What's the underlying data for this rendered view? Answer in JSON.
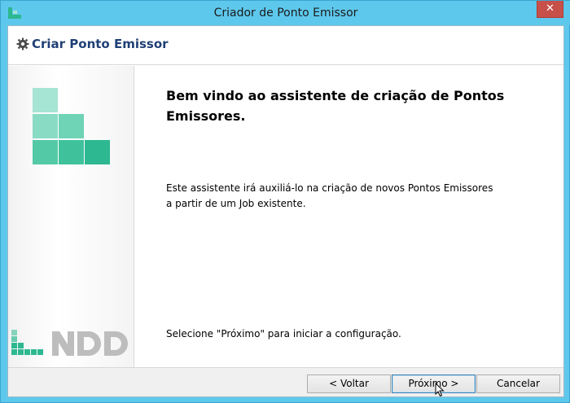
{
  "window": {
    "title": "Criador de Ponto Emissor",
    "close_glyph": "✕"
  },
  "header": {
    "title": "Criar Ponto Emissor",
    "icon": "gear-icon"
  },
  "sidebar": {
    "logo_text": "NDD",
    "colors": {
      "light": "#a6e4d3",
      "mid": "#6fd3b6",
      "dark": "#2db891"
    }
  },
  "content": {
    "welcome": "Bem vindo ao assistente de criação de Pontos Emissores.",
    "description_line1": "Este assistente irá auxiliá-lo na criação de novos Pontos Emissores",
    "description_line2": "a partir de um Job existente.",
    "hint": "Selecione \"Próximo\" para iniciar a configuração."
  },
  "footer": {
    "back_label": "<  Voltar",
    "next_label": "Próximo  >",
    "cancel_label": "Cancelar"
  }
}
